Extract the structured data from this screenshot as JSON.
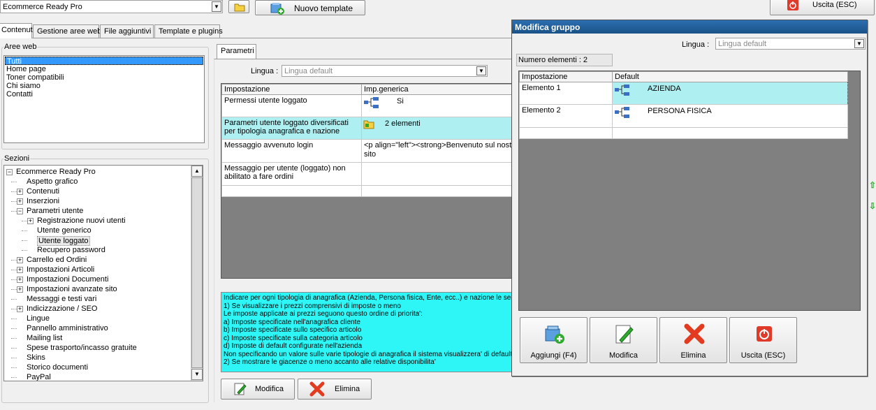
{
  "toolbar": {
    "project_select": "Ecommerce Ready Pro",
    "new_template_label": "Nuovo template",
    "exit_label": "Uscita (ESC)"
  },
  "tabs": [
    {
      "label": "Contenuti",
      "active": true
    },
    {
      "label": "Gestione aree web",
      "active": false
    },
    {
      "label": "File aggiuntivi",
      "active": false
    },
    {
      "label": "Template e plugins",
      "active": false
    }
  ],
  "aree_web": {
    "title": "Aree web",
    "items": [
      "Tutti",
      "Home page",
      "Toner compatibili",
      "Chi siamo",
      "Contatti"
    ],
    "selected_index": 0
  },
  "sezioni": {
    "title": "Sezioni",
    "items": [
      {
        "label": "Ecommerce Ready Pro",
        "level": 0,
        "expander": "−"
      },
      {
        "label": "Aspetto grafico",
        "level": 1,
        "expander": ""
      },
      {
        "label": "Contenuti",
        "level": 1,
        "expander": "+"
      },
      {
        "label": "Inserzioni",
        "level": 1,
        "expander": "+"
      },
      {
        "label": "Parametri utente",
        "level": 1,
        "expander": "−"
      },
      {
        "label": "Registrazione nuovi utenti",
        "level": 2,
        "expander": "+"
      },
      {
        "label": "Utente generico",
        "level": 2,
        "expander": ""
      },
      {
        "label": "Utente loggato",
        "level": 2,
        "expander": "",
        "selected": true
      },
      {
        "label": "Recupero password",
        "level": 2,
        "expander": ""
      },
      {
        "label": "Carrello ed Ordini",
        "level": 1,
        "expander": "+"
      },
      {
        "label": "Impostazioni Articoli",
        "level": 1,
        "expander": "+"
      },
      {
        "label": "Impostazioni Documenti",
        "level": 1,
        "expander": "+"
      },
      {
        "label": "Impostazioni avanzate sito",
        "level": 1,
        "expander": "+"
      },
      {
        "label": "Messaggi e testi vari",
        "level": 1,
        "expander": ""
      },
      {
        "label": "Indicizzazione / SEO",
        "level": 1,
        "expander": "+"
      },
      {
        "label": "Lingue",
        "level": 1,
        "expander": ""
      },
      {
        "label": "Pannello amministrativo",
        "level": 1,
        "expander": ""
      },
      {
        "label": "Mailing list",
        "level": 1,
        "expander": ""
      },
      {
        "label": "Spese trasporto/incasso gratuite",
        "level": 1,
        "expander": ""
      },
      {
        "label": "Skins",
        "level": 1,
        "expander": ""
      },
      {
        "label": "Storico documenti",
        "level": 1,
        "expander": ""
      },
      {
        "label": "PayPal",
        "level": 1,
        "expander": ""
      }
    ]
  },
  "parametri": {
    "tab_label": "Parametri",
    "lingua_label": "Lingua :",
    "lingua_value": "Lingua default",
    "headers": [
      "Impostazione",
      "Imp.generica"
    ],
    "rows": [
      {
        "name": "Permessi utente loggato",
        "value": "Si",
        "icon": "tree-icon"
      },
      {
        "name": "Parametri utente loggato diversificati per tipologia anagrafica e nazione",
        "value": "2 elementi",
        "icon": "folder-icon",
        "highlight": true
      },
      {
        "name": "Messaggio avvenuto login",
        "value": "<p align=\"left\"><strong>Benvenuto sul nostro sito",
        "icon": ""
      },
      {
        "name": "Messaggio per utente (loggato) non abilitato a fare ordini",
        "value": "",
        "icon": ""
      }
    ],
    "help_lines": [
      "Indicare per ogni tipologia di anagrafica (Azienda, Persona fisica, Ente, ecc..) e nazione le seg",
      "1) Se visualizzare i prezzi comprensivi di imposte o meno",
      "Le imposte applicate ai prezzi seguono questo ordine di priorita':",
      "a) Imposte specificate nell'anagrafica cliente",
      "b) Imposte specificate sullo specifico articolo",
      "c) Imposte specificate sulla categoria articolo",
      "d) Imposte di default configurate nell'azienda",
      "Non specificando un valore sulle varie tipologie di anagrafica il sistema visualizzera' di default",
      "2) Se mostrare le giacenze o meno accanto alle relative disponibilita'"
    ],
    "modifica_label": "Modifica",
    "elimina_label": "Elimina"
  },
  "dialog": {
    "title": "Modifica gruppo",
    "lingua_label": "Lingua :",
    "lingua_value": "Lingua default",
    "count_label": "Numero elementi : 2",
    "headers": [
      "Impostazione",
      "Default"
    ],
    "rows": [
      {
        "name": "Elemento 1",
        "value": "AZIENDA",
        "selected": true
      },
      {
        "name": "Elemento 2",
        "value": "PERSONA FISICA",
        "selected": false
      }
    ],
    "buttons": {
      "add": "Aggiungi (F4)",
      "edit": "Modifica",
      "delete": "Elimina",
      "exit": "Uscita (ESC)"
    }
  },
  "colors": {
    "dialog_title_bg": "#1f5f99",
    "selection_blue": "#3399ff",
    "highlight_cyan": "#aeeff1",
    "help_bg": "#2ff6f6",
    "grid_empty": "#808080"
  }
}
